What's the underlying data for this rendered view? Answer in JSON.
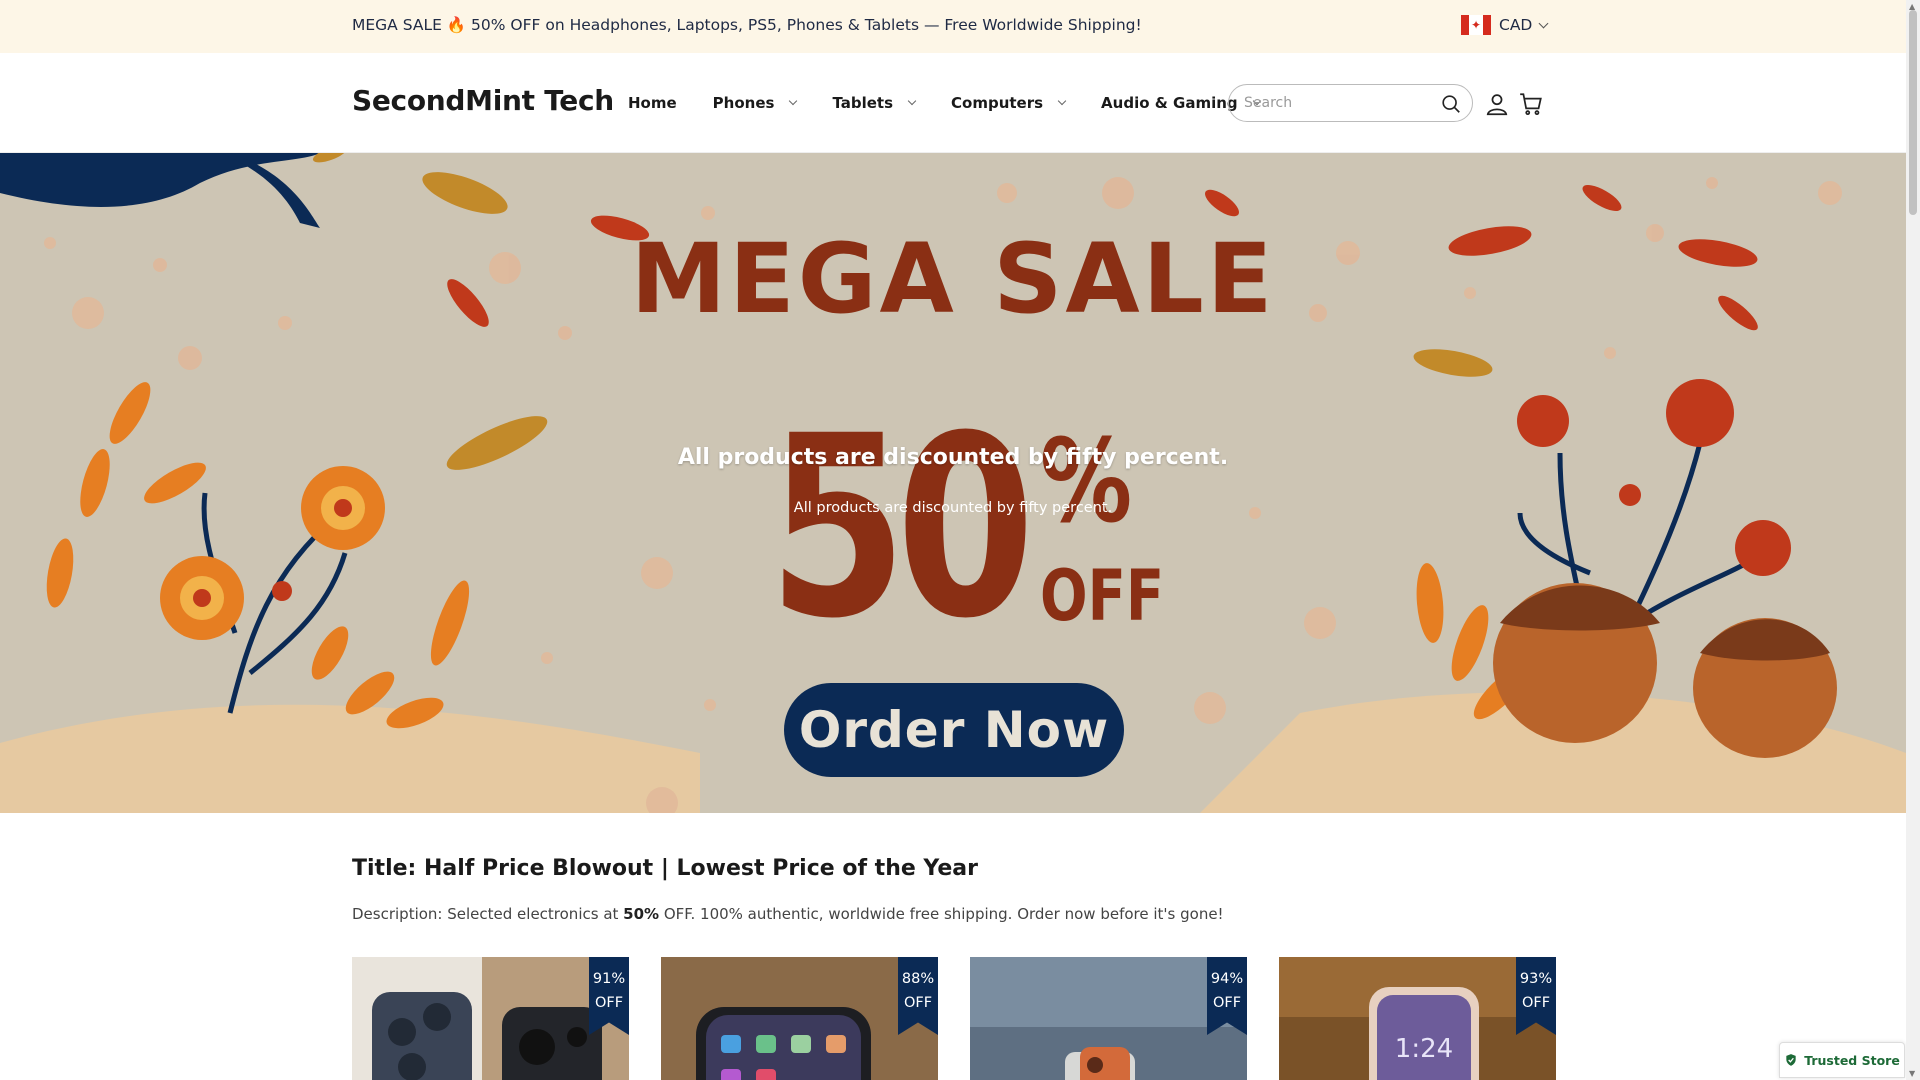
{
  "announcement": {
    "text": "MEGA SALE 🔥 50% OFF on Headphones, Laptops, PS5, Phones & Tablets — Free Worldwide Shipping!",
    "currency": "CAD",
    "flag": "canada-flag-icon"
  },
  "header": {
    "logo": "SecondMint Tech",
    "nav": [
      {
        "label": "Home",
        "dropdown": false
      },
      {
        "label": "Phones",
        "dropdown": true
      },
      {
        "label": "Tablets",
        "dropdown": true
      },
      {
        "label": "Computers",
        "dropdown": true
      },
      {
        "label": "Audio & Gaming",
        "dropdown": true
      }
    ],
    "search_placeholder": "Search"
  },
  "hero": {
    "title": "MEGA SALE",
    "big_number": "50",
    "percent": "%",
    "off": "OFF",
    "button": "Order Now",
    "overlay_heading": "All products are discounted by fifty percent.",
    "overlay_subheading": "All products are discounted by fifty percent."
  },
  "section": {
    "title": "Title: Half Price Blowout | Lowest Price of the Year",
    "desc_before": "Description: Selected electronics at ",
    "desc_bold": "50%",
    "desc_after": " OFF. 100% authentic, worldwide free shipping. Order now before it's gone!"
  },
  "products": [
    {
      "discount_pct": "91%",
      "discount_word": "OFF"
    },
    {
      "discount_pct": "88%",
      "discount_word": "OFF"
    },
    {
      "discount_pct": "94%",
      "discount_word": "OFF"
    },
    {
      "discount_pct": "93%",
      "discount_word": "OFF"
    }
  ],
  "trusted_badge": "Trusted Store",
  "colors": {
    "accent_navy": "#0b2a55",
    "sale_red": "#8a2f14",
    "announce_bg": "#fdf6e7",
    "hero_bg": "#cdc5b4",
    "trusted_green": "#1d6a37"
  }
}
